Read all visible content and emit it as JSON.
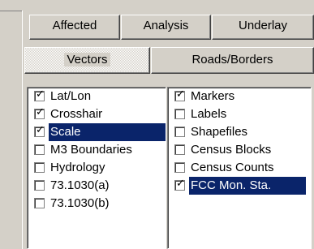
{
  "top_tabs": [
    {
      "label": "Affected"
    },
    {
      "label": "Analysis"
    },
    {
      "label": "Underlay"
    }
  ],
  "sub_tabs": [
    {
      "label": "Vectors",
      "active": true
    },
    {
      "label": "Roads/Borders",
      "active": false
    }
  ],
  "left_list": [
    {
      "label": "Lat/Lon",
      "checked": true,
      "selected": false
    },
    {
      "label": "Crosshair",
      "checked": true,
      "selected": false
    },
    {
      "label": "Scale",
      "checked": true,
      "selected": true
    },
    {
      "label": "M3 Boundaries",
      "checked": false,
      "selected": false
    },
    {
      "label": "Hydrology",
      "checked": false,
      "selected": false
    },
    {
      "label": "73.1030(a)",
      "checked": false,
      "selected": false
    },
    {
      "label": "73.1030(b)",
      "checked": false,
      "selected": false
    }
  ],
  "right_list": [
    {
      "label": "Markers",
      "checked": true,
      "selected": false
    },
    {
      "label": "Labels",
      "checked": false,
      "selected": false
    },
    {
      "label": "Shapefiles",
      "checked": false,
      "selected": false
    },
    {
      "label": "Census Blocks",
      "checked": false,
      "selected": false
    },
    {
      "label": "Census Counts",
      "checked": false,
      "selected": false
    },
    {
      "label": "FCC Mon. Sta.",
      "checked": true,
      "selected": true
    }
  ],
  "colors": {
    "face": "#d4d0c8",
    "selection": "#0a246a",
    "list_bg": "#ffffff"
  },
  "icons": {
    "check": "check-mark-icon"
  }
}
